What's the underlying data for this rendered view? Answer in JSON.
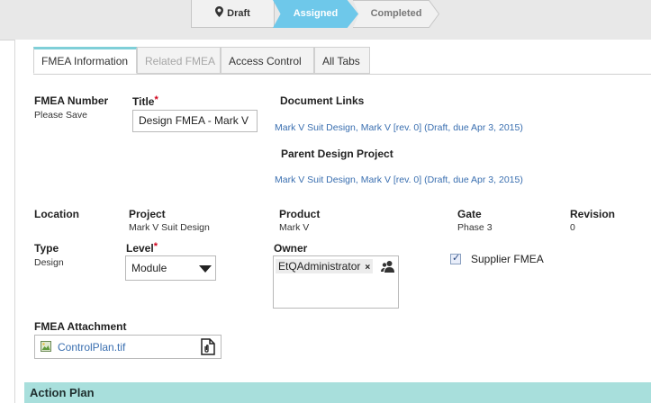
{
  "workflow": {
    "steps": [
      {
        "label": "Draft",
        "state": "done"
      },
      {
        "label": "Assigned",
        "state": "current"
      },
      {
        "label": "Completed",
        "state": "pending"
      }
    ],
    "current_color": "#6ec8ea"
  },
  "tabs": [
    {
      "label": "FMEA Information",
      "active": true
    },
    {
      "label": "Related FMEA",
      "disabled": true
    },
    {
      "label": "Access Control"
    },
    {
      "label": "All Tabs"
    }
  ],
  "form": {
    "fmea_number": {
      "label": "FMEA Number",
      "value": "Please Save"
    },
    "title": {
      "label": "Title",
      "required_mark": "*",
      "value": "Design FMEA - Mark V"
    },
    "document_links": {
      "label": "Document Links",
      "link": "Mark V Suit Design, Mark V [rev. 0] (Draft, due Apr 3, 2015)"
    },
    "parent_design_project": {
      "label": "Parent Design Project",
      "link": "Mark V Suit Design, Mark V [rev. 0] (Draft, due Apr 3, 2015)"
    },
    "location": {
      "label": "Location"
    },
    "project": {
      "label": "Project",
      "value": "Mark V Suit Design"
    },
    "product": {
      "label": "Product",
      "value": "Mark V"
    },
    "gate": {
      "label": "Gate",
      "value": "Phase 3"
    },
    "revision": {
      "label": "Revision",
      "value": "0"
    },
    "type": {
      "label": "Type",
      "value": "Design"
    },
    "level": {
      "label": "Level",
      "required_mark": "*",
      "selected": "Module"
    },
    "owner": {
      "label": "Owner",
      "chip": "EtQAdministrator",
      "remove": "×"
    },
    "supplier_fmea": {
      "label": "Supplier FMEA",
      "checked": true,
      "check": "✓"
    },
    "attachment": {
      "label": "FMEA Attachment",
      "file": "ControlPlan.tif"
    }
  },
  "sections": {
    "action_plan": {
      "label": "Action Plan",
      "color": "#a8dfdc"
    }
  },
  "icons": [
    "map-pin-icon",
    "user-picker-icon",
    "image-file-icon",
    "document-attach-icon",
    "chevron-down-icon"
  ]
}
